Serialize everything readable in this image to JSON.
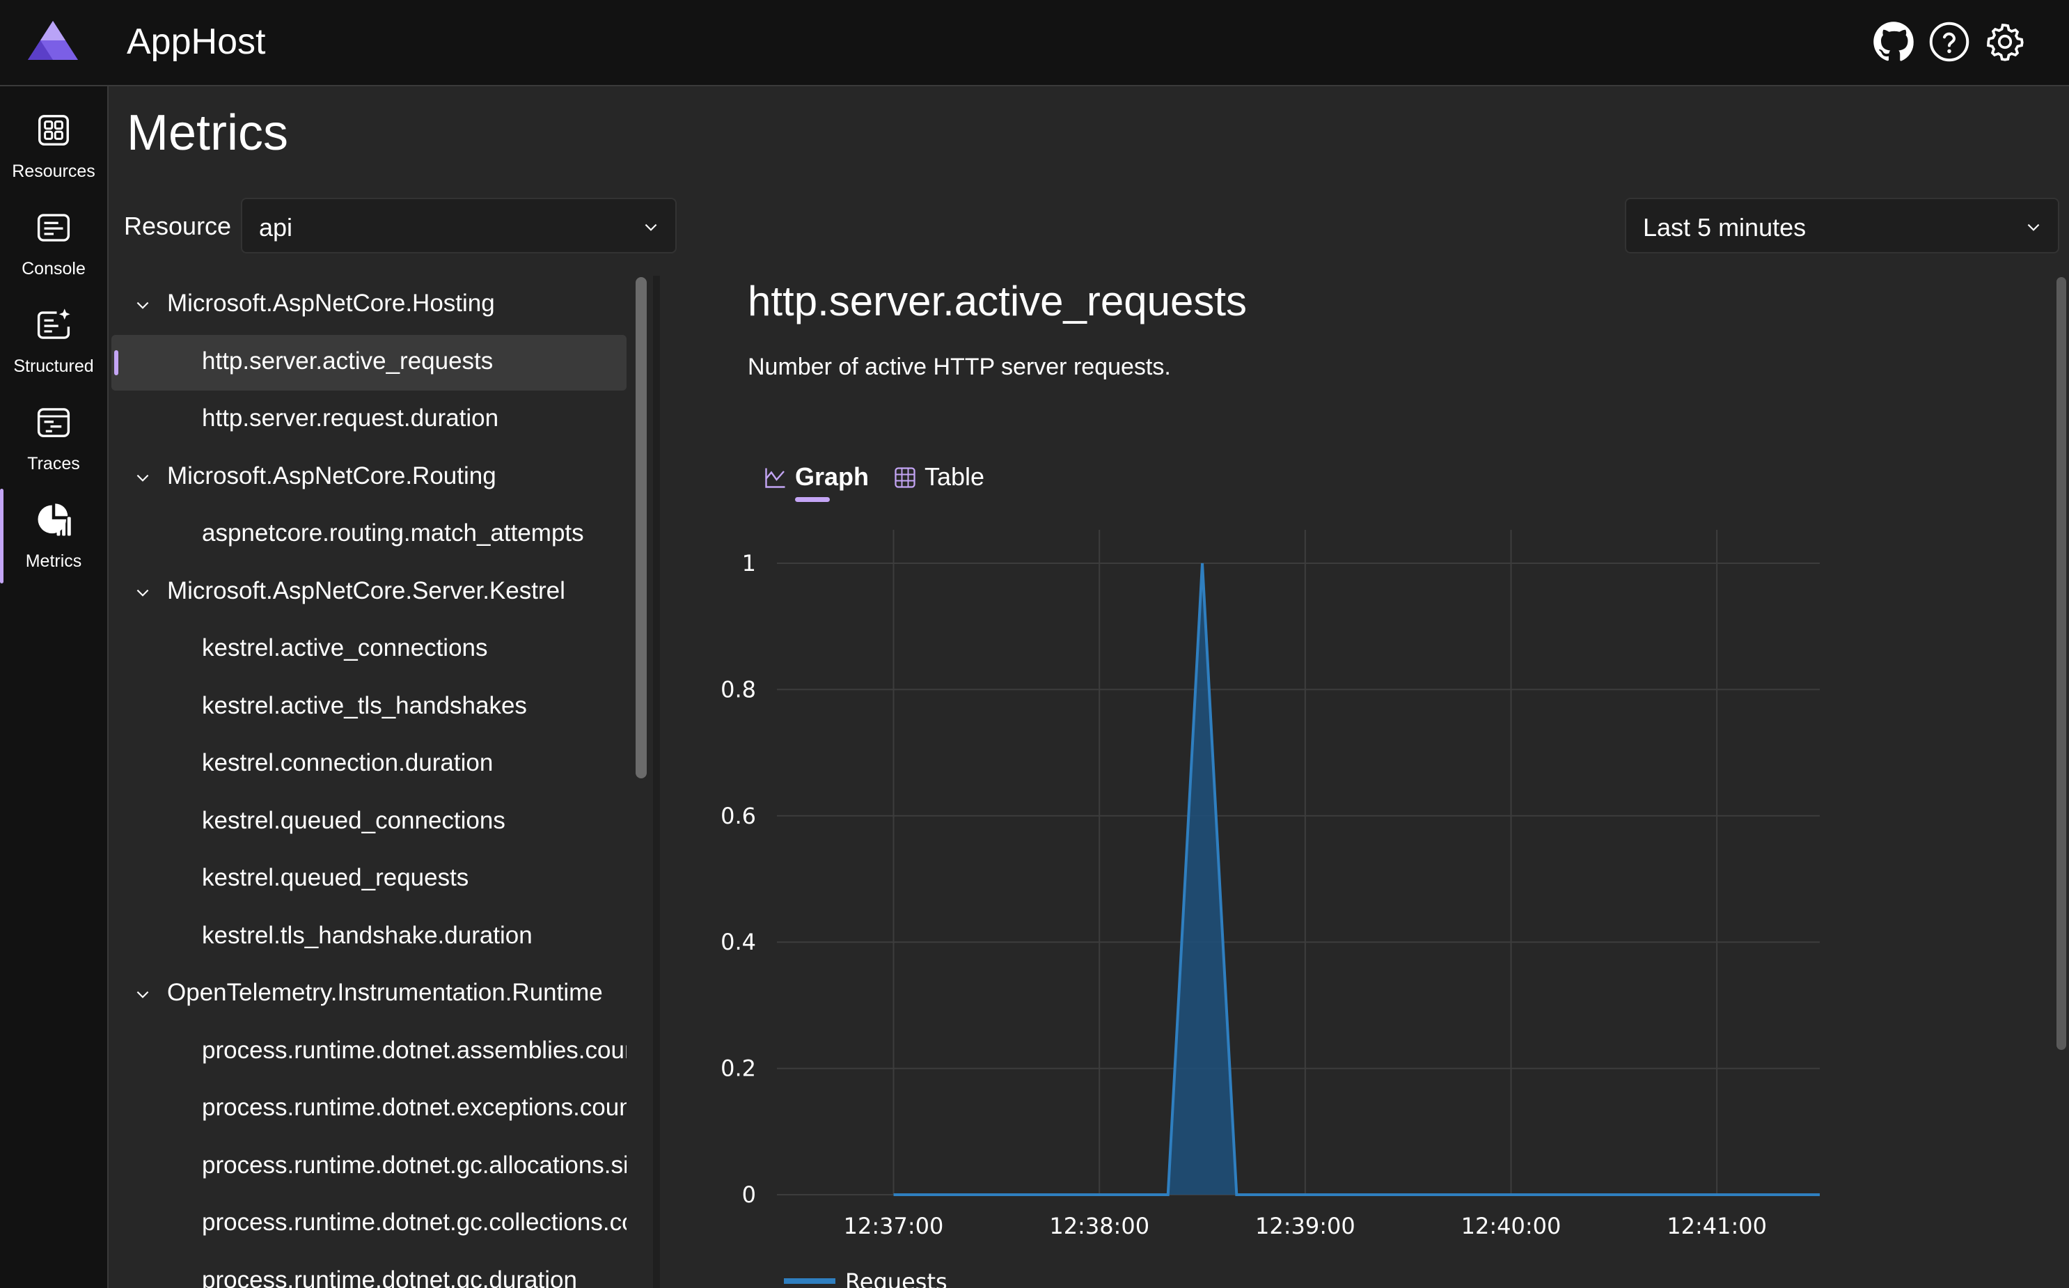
{
  "header": {
    "app_title": "AppHost",
    "icons": [
      "github-icon",
      "help-icon",
      "settings-icon"
    ]
  },
  "nav": {
    "items": [
      {
        "label": "Resources",
        "icon": "resources-icon"
      },
      {
        "label": "Console",
        "icon": "console-icon"
      },
      {
        "label": "Structured",
        "icon": "structured-logs-icon"
      },
      {
        "label": "Traces",
        "icon": "traces-icon"
      },
      {
        "label": "Metrics",
        "icon": "metrics-icon",
        "active": true
      }
    ]
  },
  "page": {
    "title": "Metrics",
    "resource_label": "Resource",
    "resource_value": "api",
    "time_range": "Last 5 minutes"
  },
  "tree": {
    "items": [
      {
        "type": "group",
        "label": "Microsoft.AspNetCore.Hosting"
      },
      {
        "type": "metric",
        "label": "http.server.active_requests",
        "selected": true
      },
      {
        "type": "metric",
        "label": "http.server.request.duration"
      },
      {
        "type": "group",
        "label": "Microsoft.AspNetCore.Routing"
      },
      {
        "type": "metric",
        "label": "aspnetcore.routing.match_attempts"
      },
      {
        "type": "group",
        "label": "Microsoft.AspNetCore.Server.Kestrel"
      },
      {
        "type": "metric",
        "label": "kestrel.active_connections"
      },
      {
        "type": "metric",
        "label": "kestrel.active_tls_handshakes"
      },
      {
        "type": "metric",
        "label": "kestrel.connection.duration"
      },
      {
        "type": "metric",
        "label": "kestrel.queued_connections"
      },
      {
        "type": "metric",
        "label": "kestrel.queued_requests"
      },
      {
        "type": "metric",
        "label": "kestrel.tls_handshake.duration"
      },
      {
        "type": "group",
        "label": "OpenTelemetry.Instrumentation.Runtime"
      },
      {
        "type": "metric",
        "label": "process.runtime.dotnet.assemblies.count"
      },
      {
        "type": "metric",
        "label": "process.runtime.dotnet.exceptions.count"
      },
      {
        "type": "metric",
        "label": "process.runtime.dotnet.gc.allocations.size"
      },
      {
        "type": "metric",
        "label": "process.runtime.dotnet.gc.collections.count"
      },
      {
        "type": "metric",
        "label": "process.runtime.dotnet.gc.duration"
      }
    ]
  },
  "metric": {
    "title": "http.server.active_requests",
    "description": "Number of active HTTP server requests.",
    "tabs": [
      {
        "label": "Graph",
        "active": true
      },
      {
        "label": "Table"
      }
    ]
  },
  "chart_data": {
    "type": "area",
    "x": [
      "12:37:00",
      "12:38:00",
      "12:38:20",
      "12:38:30",
      "12:38:40",
      "12:39:00",
      "12:40:00",
      "12:41:00",
      "12:41:30"
    ],
    "series": [
      {
        "name": "Requests",
        "values": [
          0,
          0,
          0,
          1,
          0,
          0,
          0,
          0,
          0
        ]
      }
    ],
    "xticks": [
      "12:37:00",
      "12:38:00",
      "12:39:00",
      "12:40:00",
      "12:41:00"
    ],
    "yticks": [
      "0",
      "0.2",
      "0.4",
      "0.6",
      "0.8",
      "1"
    ],
    "ylim": [
      0,
      1
    ],
    "grid": true,
    "legend": "bottom",
    "line_color": "#2f7fc0",
    "fill_color": "#1f4f78"
  },
  "colors": {
    "accent": "#c4a5f5",
    "background": "#272727",
    "header": "#121212"
  }
}
